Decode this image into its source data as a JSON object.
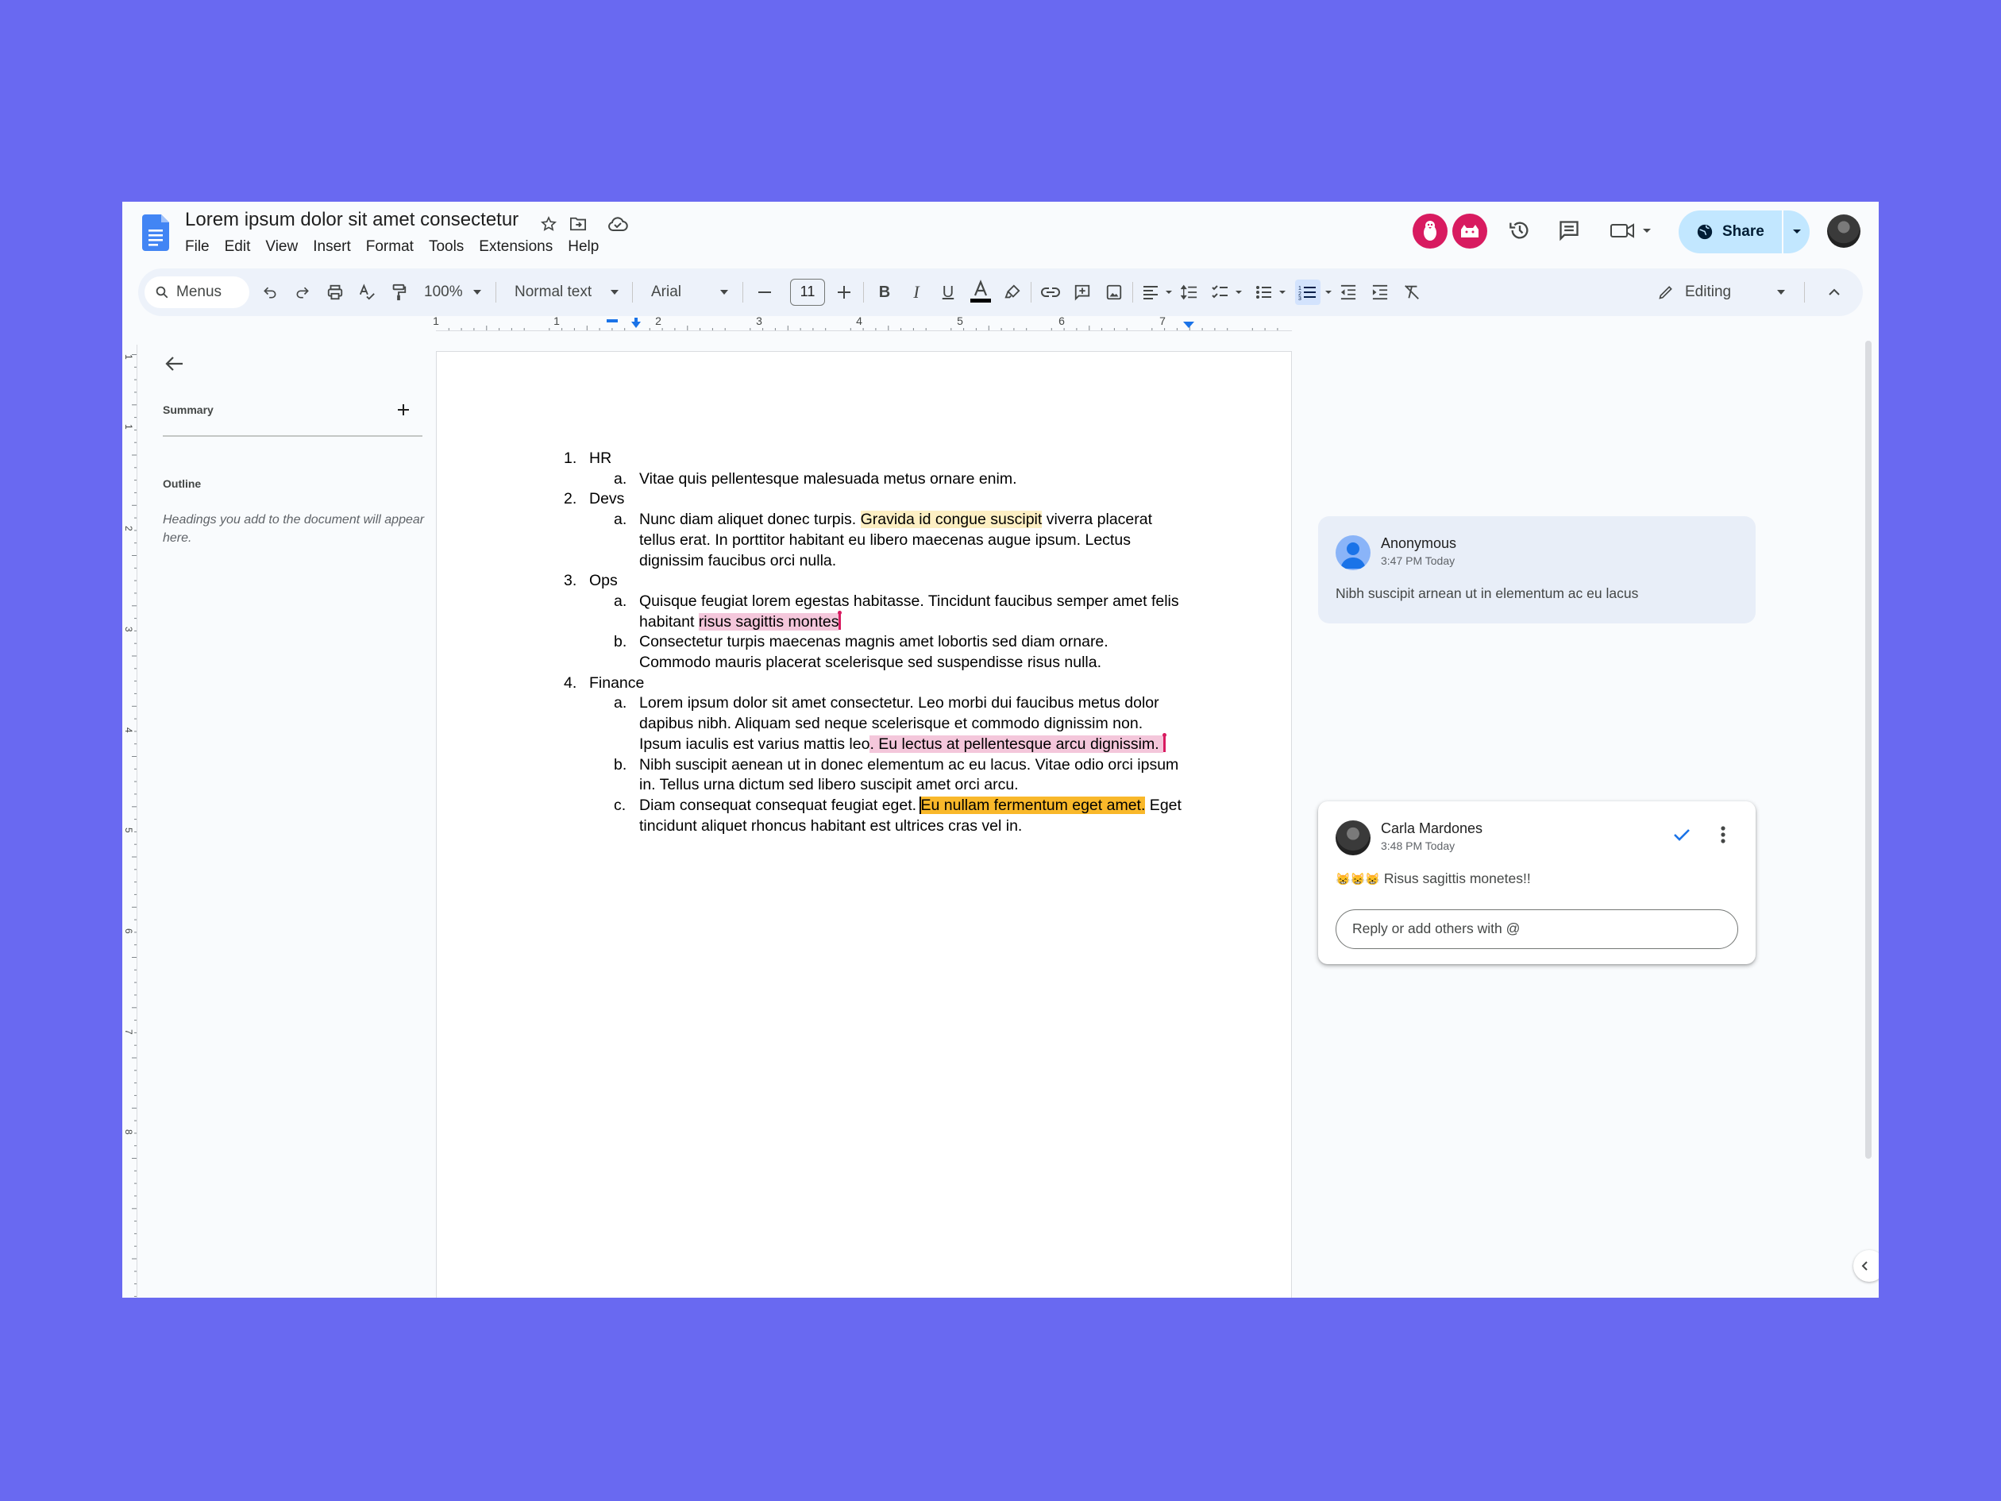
{
  "app": {
    "doc_title": "Lorem ipsum dolor sit amet consectetur",
    "menu": [
      "File",
      "Edit",
      "View",
      "Insert",
      "Format",
      "Tools",
      "Extensions",
      "Help"
    ],
    "share_label": "Share"
  },
  "toolbar": {
    "search_label": "Menus",
    "zoom": "100%",
    "style": "Normal text",
    "font": "Arial",
    "font_size": "11",
    "mode": "Editing"
  },
  "ruler": {
    "marks": [
      "1",
      "1",
      "2",
      "3",
      "4",
      "5",
      "6",
      "7"
    ]
  },
  "vruler": {
    "marks": [
      "1",
      "1",
      "2",
      "3",
      "4",
      "5",
      "6",
      "7",
      "8"
    ]
  },
  "sidebar": {
    "summary_label": "Summary",
    "outline_label": "Outline",
    "outline_hint": "Headings you add to the document will appear here."
  },
  "document": {
    "i1": {
      "num": "1.",
      "text": "HR"
    },
    "i1a": {
      "num": "a.",
      "text": "Vitae quis pellentesque malesuada metus ornare enim."
    },
    "i2": {
      "num": "2.",
      "text": "Devs"
    },
    "i2a": {
      "num": "a.",
      "pre": "Nunc diam aliquet donec turpis. ",
      "hl": "Gravida id congue suscipit",
      "post": " viverra placerat tellus erat. In porttitor habitant eu libero maecenas augue ipsum. Lectus dignissim faucibus orci nulla."
    },
    "i3": {
      "num": "3.",
      "text": "Ops"
    },
    "i3a": {
      "num": "a.",
      "pre": "Quisque feugiat lorem egestas habitasse. Tincidunt faucibus semper amet felis habitant ",
      "hl": "risus sagittis montes"
    },
    "i3b": {
      "num": "b.",
      "text": "Consectetur turpis maecenas magnis amet lobortis sed diam ornare. Commodo mauris placerat scelerisque sed suspendisse risus nulla."
    },
    "i4": {
      "num": "4.",
      "text": "Finance"
    },
    "i4a": {
      "num": "a.",
      "pre": "Lorem ipsum dolor sit amet consectetur. Leo morbi dui faucibus metus dolor dapibus nibh. Aliquam sed neque scelerisque et commodo dignissim non. Ipsum iaculis est varius mattis leo",
      "hl": ". Eu lectus at pellentesque arcu dignissim. "
    },
    "i4b": {
      "num": "b.",
      "text": "Nibh suscipit aenean ut in donec elementum ac eu lacus. Vitae odio orci ipsum in. Tellus urna dictum sed libero suscipit amet orci arcu."
    },
    "i4c": {
      "num": "c.",
      "pre": "Diam consequat consequat feugiat eget. ",
      "hl": "Eu nullam fermentum eget amet.",
      "post": " Eget tincidunt aliquet rhoncus habitant est ultrices cras vel in."
    }
  },
  "comments": [
    {
      "author": "Anonymous",
      "time": "3:47 PM Today",
      "text": "Nibh suscipit arnean ut in elementum ac eu lacus"
    },
    {
      "author": "Carla Mardones",
      "time": "3:48 PM Today",
      "emoji": "😸😸😸",
      "text": "Risus sagittis monetes!!",
      "reply_placeholder": "Reply or add others with @"
    }
  ],
  "colors": {
    "background": "#6969f1",
    "window": "#f9fbfd",
    "toolbar": "#edf2fa",
    "share": "#c2e7ff",
    "highlight_yellow": "#fdefc3",
    "highlight_pink": "#f4c7db",
    "highlight_orange": "#f9b82a",
    "accent_blue": "#1a73e8",
    "avatar_pink": "#d81b60"
  }
}
